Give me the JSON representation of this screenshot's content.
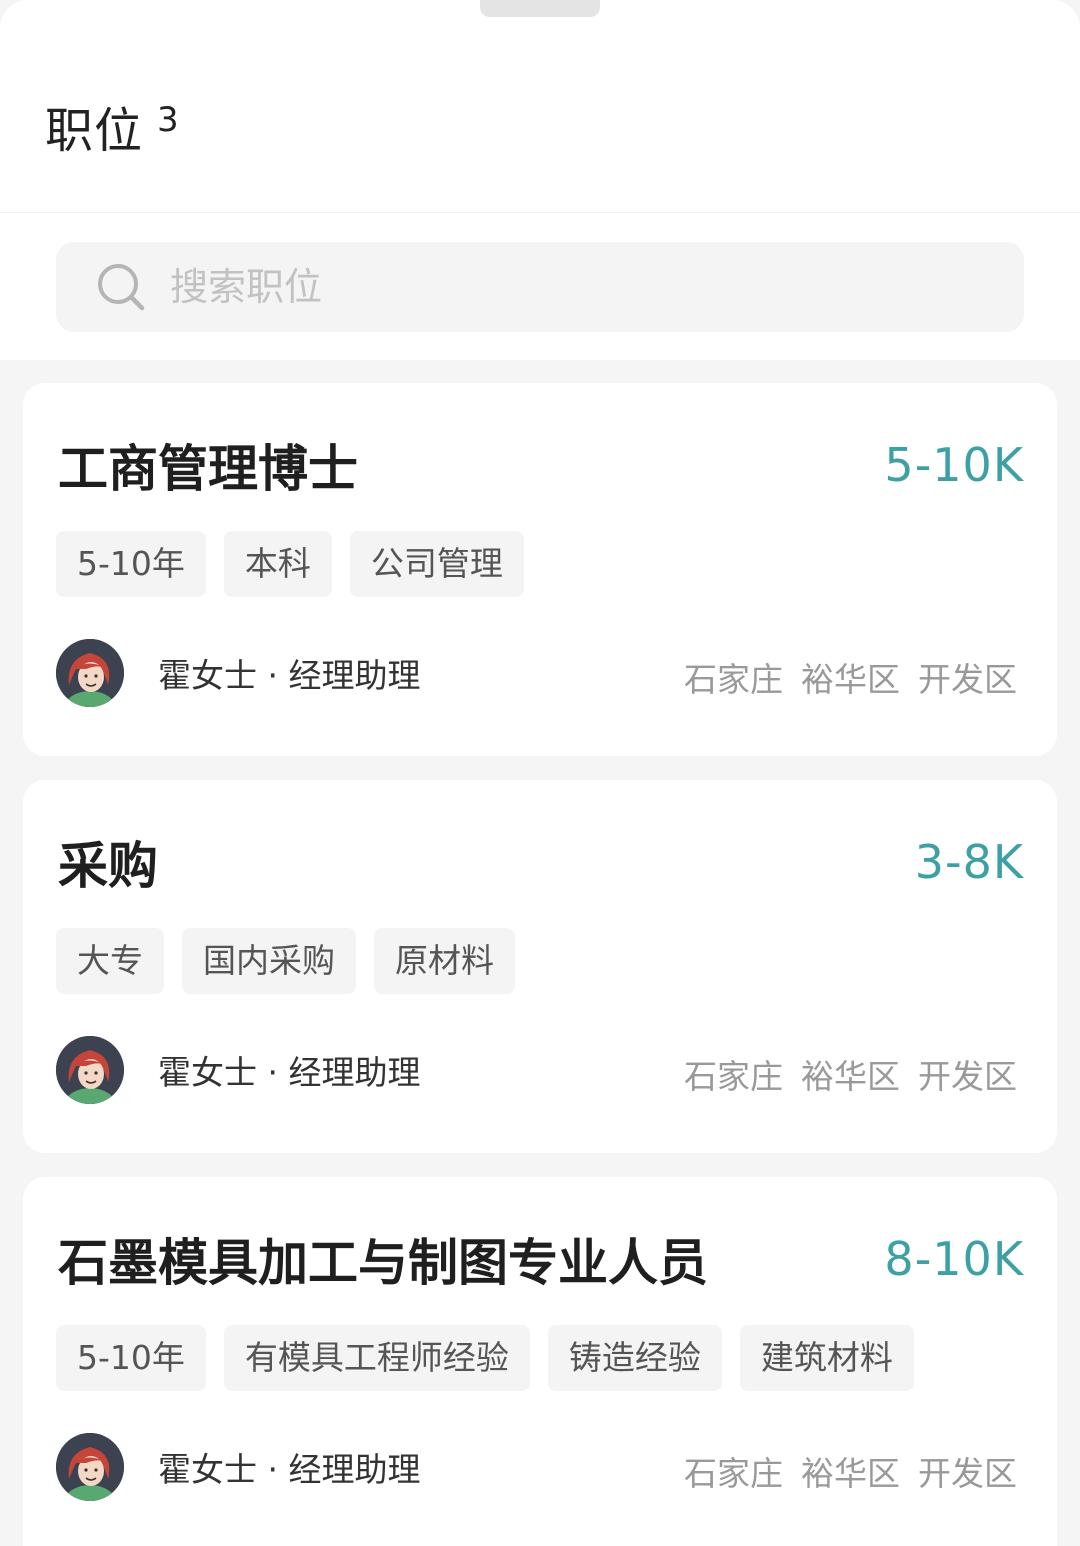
{
  "header": {
    "title": "职位",
    "count": "3"
  },
  "search": {
    "placeholder": "搜索职位"
  },
  "jobs": [
    {
      "title": "工商管理博士",
      "salary": "5-10K",
      "tags": [
        "5-10年",
        "本科",
        "公司管理"
      ],
      "recruiter": {
        "name": "霍女士",
        "separator": "·",
        "role": "经理助理"
      },
      "location": [
        "石家庄",
        "裕华区",
        "开发区"
      ]
    },
    {
      "title": "采购",
      "salary": "3-8K",
      "tags": [
        "大专",
        "国内采购",
        "原材料"
      ],
      "recruiter": {
        "name": "霍女士",
        "separator": "·",
        "role": "经理助理"
      },
      "location": [
        "石家庄",
        "裕华区",
        "开发区"
      ]
    },
    {
      "title": "石墨模具加工与制图专业人员",
      "salary": "8-10K",
      "tags": [
        "5-10年",
        "有模具工程师经验",
        "铸造经验",
        "建筑材料"
      ],
      "recruiter": {
        "name": "霍女士",
        "separator": "·",
        "role": "经理助理"
      },
      "location": [
        "石家庄",
        "裕华区",
        "开发区"
      ]
    }
  ],
  "colors": {
    "salary": "#3da0a4",
    "background": "#f5f5f5",
    "card": "#ffffff"
  },
  "icons": {
    "search": "search-icon",
    "avatar": "avatar-female"
  }
}
